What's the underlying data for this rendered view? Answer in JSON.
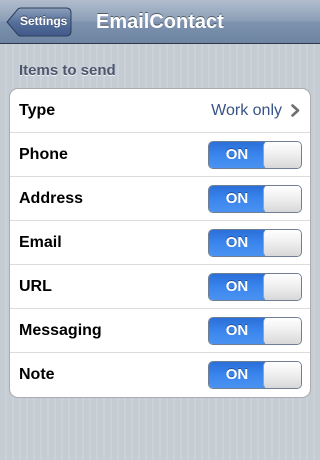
{
  "navbar": {
    "back_label": "Settings",
    "title": "EmailContact"
  },
  "section": {
    "header": "Items to send"
  },
  "rows": [
    {
      "label": "Type",
      "value": "Work only"
    },
    {
      "label": "Phone",
      "toggle": "ON",
      "on": true
    },
    {
      "label": "Address",
      "toggle": "ON",
      "on": true
    },
    {
      "label": "Email",
      "toggle": "ON",
      "on": true
    },
    {
      "label": "URL",
      "toggle": "ON",
      "on": true
    },
    {
      "label": "Messaging",
      "toggle": "ON",
      "on": true
    },
    {
      "label": "Note",
      "toggle": "ON",
      "on": true
    }
  ],
  "colors": {
    "toggle_on": "#3a85ee",
    "navbar": "#8a9db6",
    "value_text": "#385487"
  }
}
